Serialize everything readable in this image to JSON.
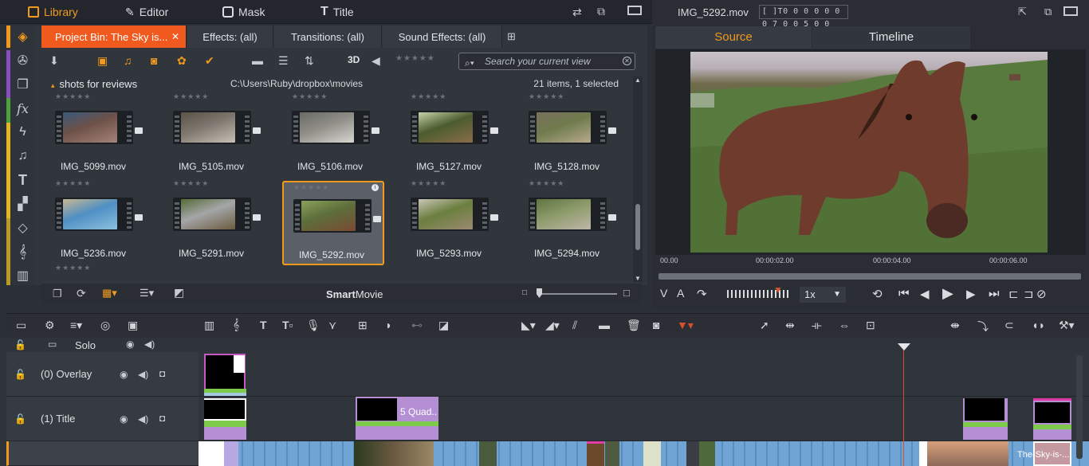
{
  "topbar": {
    "modes": [
      {
        "label": "Library",
        "icon": "library-icon",
        "active": true
      },
      {
        "label": "Editor",
        "icon": "editor-icon",
        "active": false
      },
      {
        "label": "Mask",
        "icon": "mask-icon",
        "active": false
      },
      {
        "label": "Title",
        "icon": "title-icon",
        "active": false
      }
    ]
  },
  "library": {
    "tabs": [
      {
        "label": "Project Bin: The Sky is...",
        "active": true
      },
      {
        "label": "Effects: (all)"
      },
      {
        "label": "Transitions: (all)"
      },
      {
        "label": "Sound Effects: (all)"
      }
    ],
    "search_placeholder": "Search your current view",
    "toolbar_3d_label": "3D",
    "collection_title": "shots for reviews",
    "path": "C:\\Users\\Ruby\\dropbox\\movies",
    "count": "21 items, 1 selected",
    "items": [
      {
        "name": "IMG_5099.mov",
        "thumb": [
          "#6e5148",
          "#a4847a",
          "#3a5a7a"
        ]
      },
      {
        "name": "IMG_5105.mov",
        "thumb": [
          "#7d776f",
          "#c7c0b4",
          "#5b5146"
        ]
      },
      {
        "name": "IMG_5106.mov",
        "thumb": [
          "#8e8d86",
          "#d8d6d0",
          "#6a6a66"
        ]
      },
      {
        "name": "IMG_5127.mov",
        "thumb": [
          "#4c5c2e",
          "#8a6d4a",
          "#c5d2a8"
        ]
      },
      {
        "name": "IMG_5128.mov",
        "thumb": [
          "#6f7b4d",
          "#b7a98c",
          "#7b6f5c"
        ]
      },
      {
        "name": "IMG_5236.mov",
        "thumb": [
          "#4f8fc4",
          "#8bc1de",
          "#c9b893"
        ]
      },
      {
        "name": "IMG_5291.mov",
        "thumb": [
          "#a4a6a8",
          "#6d5b3f",
          "#556b36"
        ]
      },
      {
        "name": "IMG_5292.mov",
        "thumb": [
          "#5d6e3b",
          "#7a4a34",
          "#8aa05a"
        ],
        "selected": true
      },
      {
        "name": "IMG_5293.mov",
        "thumb": [
          "#6b7f3f",
          "#9b8a70",
          "#c9c4b4"
        ]
      },
      {
        "name": "IMG_5294.mov",
        "thumb": [
          "#8c9b6a",
          "#bdb6a8",
          "#5e7440"
        ]
      }
    ],
    "bottom_label_bold": "Smart",
    "bottom_label_rest": "Movie"
  },
  "preview": {
    "file_title": "IMG_5292.mov",
    "timecode": "[ ]T0 0 0 0 0 0 0 7 0 0 5 0 0",
    "tabs": [
      {
        "label": "Source",
        "active": true
      },
      {
        "label": "Timeline",
        "active": false
      }
    ],
    "ruler": [
      "00.00",
      "00:00:02.00",
      "00:00:04.00",
      "00:00:06.00"
    ],
    "speed": "1x"
  },
  "timeline": {
    "solo_label": "Solo",
    "tracks": [
      {
        "name": "(0) Overlay"
      },
      {
        "name": "(1) Title"
      }
    ],
    "clip_labels": {
      "quad": "5 Quad..",
      "sky": "The-Sky-is-..."
    }
  },
  "colors": {
    "accent": "#f19a1d",
    "active_tab": "#f05a1e",
    "playhead": "#d6502a"
  }
}
